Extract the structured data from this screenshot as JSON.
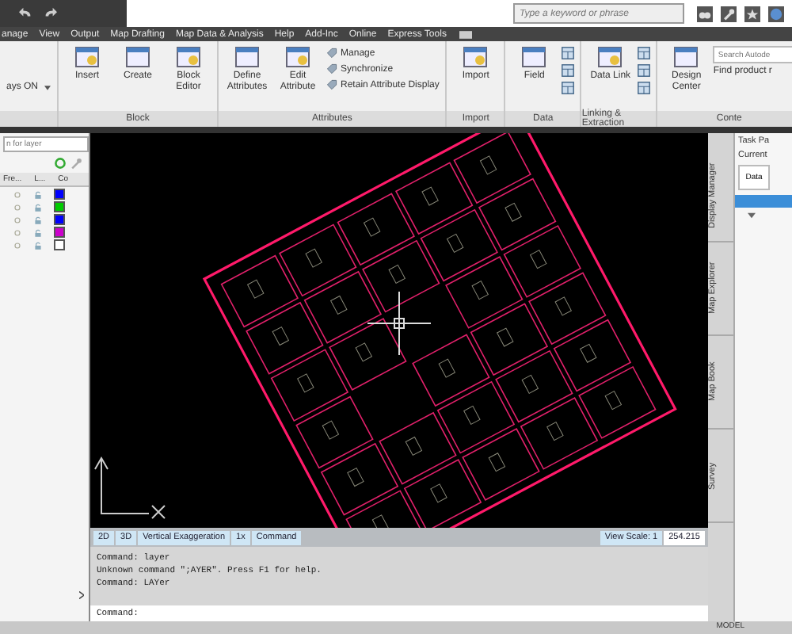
{
  "title_bar": {
    "search_placeholder": "Type a keyword or phrase"
  },
  "menu_tabs": [
    "anage",
    "View",
    "Output",
    "Map Drafting",
    "Map Data & Analysis",
    "Help",
    "Add-Inc",
    "Online",
    "Express Tools"
  ],
  "ribbon": [
    {
      "buttons": [
        {
          "kind": "dropdown",
          "label": "ays ON"
        }
      ]
    },
    {
      "title": "Block",
      "buttons": [
        {
          "kind": "large",
          "label": "Insert"
        },
        {
          "kind": "large",
          "label": "Create"
        },
        {
          "kind": "large",
          "label": "Block Editor"
        }
      ]
    },
    {
      "title": "Attributes",
      "buttons": [
        {
          "kind": "large",
          "label": "Define Attributes"
        },
        {
          "kind": "large",
          "label": "Edit Attribute"
        },
        {
          "kind": "small",
          "label": "Manage"
        },
        {
          "kind": "small",
          "label": "Synchronize"
        },
        {
          "kind": "small",
          "label": "Retain Attribute Display"
        }
      ]
    },
    {
      "title": "Import",
      "buttons": [
        {
          "kind": "large",
          "label": "Import"
        }
      ]
    },
    {
      "title": "Data",
      "buttons": [
        {
          "kind": "large",
          "label": "Field"
        },
        {
          "kind": "icons"
        }
      ]
    },
    {
      "title": "Linking & Extraction",
      "buttons": [
        {
          "kind": "large",
          "label": "Data Link"
        },
        {
          "kind": "icons"
        }
      ]
    },
    {
      "title": "Conte",
      "buttons": [
        {
          "kind": "large",
          "label": "Design Center"
        },
        {
          "kind": "search",
          "placeholder": "Search Autode",
          "note": "Find product r"
        }
      ]
    }
  ],
  "layers": {
    "search_placeholder": "n for layer",
    "columns": [
      "Fre...",
      "L...",
      "Co"
    ],
    "rows": [
      {
        "color": "#0000ff"
      },
      {
        "color": "#00cc00"
      },
      {
        "color": "#0000ff"
      },
      {
        "color": "#cc00cc"
      },
      {
        "color": "#ffffff"
      }
    ]
  },
  "viewport_status": {
    "items": [
      "2D",
      "3D",
      "Vertical Exaggeration",
      "1x",
      "Command"
    ],
    "scale_label": "View Scale: 1",
    "scale_value": "254.215"
  },
  "command_history": [
    "Command: layer",
    "Unknown command \";AYER\".  Press F1 for help.",
    "Command: LAYer"
  ],
  "command_prompt": "Command:",
  "task_pane": {
    "title": "Task Pa",
    "current": "Current",
    "data_button": "Data",
    "tabs": [
      "Display Manager",
      "Map Explorer",
      "Map Book",
      "Survey"
    ]
  },
  "status_bar": {
    "mode": "MODEL"
  }
}
